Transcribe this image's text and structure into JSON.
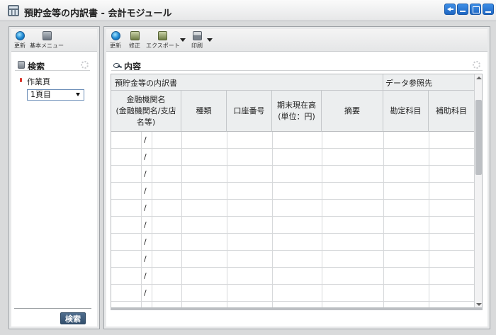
{
  "window": {
    "title": "預貯金等の内訳書 - 会計モジュール"
  },
  "left_toolbar": {
    "refresh": "更新",
    "basic_menu": "基本メニュー"
  },
  "right_toolbar": {
    "refresh": "更新",
    "edit": "修正",
    "export": "エクスポート",
    "print": "印刷"
  },
  "search_panel": {
    "title": "検索",
    "worksheet_label": "作業頁",
    "worksheet_value": "1頁目",
    "search_button": "検索"
  },
  "content": {
    "title": "内容",
    "group_main": "預貯金等の内訳書",
    "group_ref": "データ参照先",
    "columns": {
      "bank_line1": "金融機関名",
      "bank_line2": "(金融機関名/支店",
      "bank_line3": "名等)",
      "type": "種類",
      "account": "口座番号",
      "balance_line1": "期末現在高",
      "balance_line2": "(単位：円)",
      "summary": "摘要",
      "account_title": "勘定科目",
      "sub_account": "補助科目"
    },
    "rows": [
      {
        "sep": "/"
      },
      {
        "sep": "/"
      },
      {
        "sep": "/"
      },
      {
        "sep": "/"
      },
      {
        "sep": "/"
      },
      {
        "sep": "/"
      },
      {
        "sep": "/"
      },
      {
        "sep": "/"
      },
      {
        "sep": "/"
      },
      {
        "sep": "/"
      }
    ]
  }
}
